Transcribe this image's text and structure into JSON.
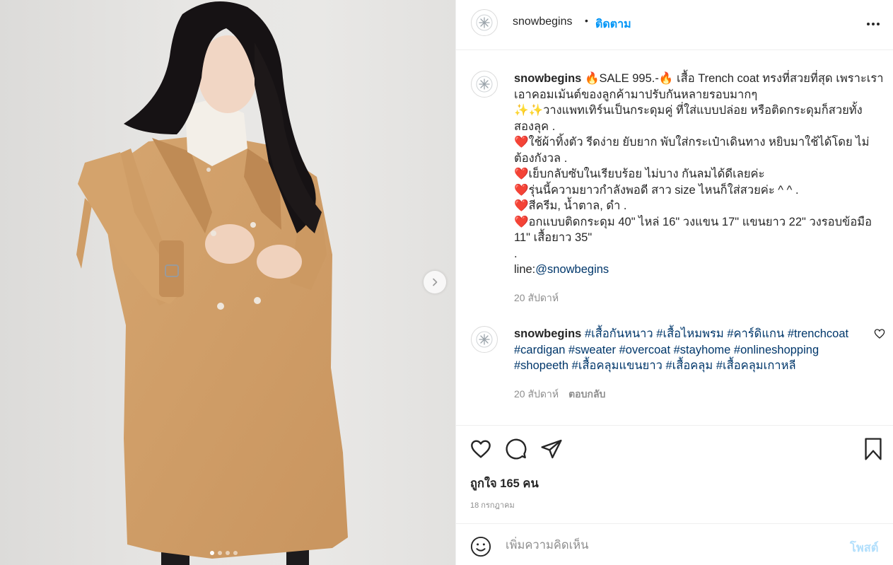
{
  "post": {
    "media": {
      "photo_alt": "",
      "slides_total": 4,
      "active_slide": 1,
      "next_icon": "chevron-right-icon"
    },
    "header": {
      "username": "snowbegins",
      "separator": "•",
      "follow_label": "ติดตาม",
      "more_icon": "more-horizontal-icon"
    },
    "caption": {
      "username": "snowbegins",
      "lines": [
        {
          "parts": [
            "🔥SALE 995.-🔥 เสื้อ Trench coat ทรงที่สวยที่สุด เพราะเรา"
          ]
        },
        {
          "parts": [
            "เอาคอมเม้นต์ของลูกค้ามาปรับกันหลายรอบมากๆ"
          ]
        },
        {
          "parts": [
            "✨✨วางแพทเทิร์นเป็นกระดุมคู่ ที่ใส่แบบปล่อย หรือติดกระดุมก็สวยทั้ง"
          ]
        },
        {
          "parts": [
            "สองลุค ."
          ]
        },
        {
          "parts": [
            "❤️ใช้ผ้าทิ้งตัว รีดง่าย ยับยาก พับใส่กระเป๋าเดินทาง หยิบมาใช้ได้โดย ไม่"
          ]
        },
        {
          "parts": [
            "ต้องกังวล ."
          ]
        },
        {
          "parts": [
            "❤️เย็บกลับซับในเรียบร้อย ไม่บาง กันลมได้ดีเลยค่ะ"
          ]
        },
        {
          "parts": [
            "❤️รุ่นนี้ความยาวกำลังพอดี สาว size ไหนก็ใส่สวยค่ะ ^ ^ ."
          ]
        },
        {
          "parts": [
            "❤️สีครีม, น้ำตาล, ดำ ."
          ]
        },
        {
          "parts": [
            "❤️อกแบบติดกระดุม 40\" ไหล่ 16\" วงแขน 17\" แขนยาว 22\" วงรอบข้อมือ"
          ]
        },
        {
          "parts": [
            "11\" เสื้อยาว 35\""
          ]
        },
        {
          "parts": [
            "."
          ]
        }
      ],
      "line_prefix": "line:",
      "line_handle": "@snowbegins",
      "time": "20 สัปดาห์"
    },
    "comment": {
      "username": "snowbegins",
      "hashtags_line1": "#เสื้อกันหนาว #เสื้อไหมพรม #คาร์ดิแกน #trenchcoat",
      "hashtags_line2": "#cardigan #sweater #overcoat #stayhome #onlineshopping",
      "hashtags_line3": "#shopeeth #เสื้อคลุมแขนยาว #เสื้อคลุม #เสื้อคลุมเกาหลี",
      "time": "20 สัปดาห์",
      "reply_label": "ตอบกลับ",
      "like_icon": "heart-outline-icon"
    },
    "actions": {
      "like_icon": "heart-icon",
      "comment_icon": "comment-bubble-icon",
      "share_icon": "paper-plane-icon",
      "save_icon": "bookmark-icon",
      "likes_text": "ถูกใจ 165 คน",
      "date": "18 กรกฎาคม"
    },
    "add_comment": {
      "emoji_icon": "smiley-icon",
      "placeholder": "เพิ่มความคิดเห็น",
      "post_label": "โพสต์"
    }
  }
}
